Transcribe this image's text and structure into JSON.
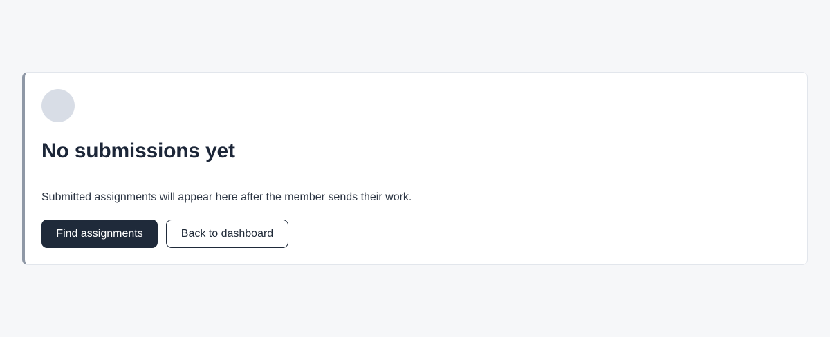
{
  "empty_state": {
    "title": "No submissions yet",
    "description": "Submitted assignments will appear here after the member sends their work.",
    "primary_action": "Find assignments",
    "secondary_action": "Back to dashboard"
  },
  "colors": {
    "page_background": "#f6f7f9",
    "card_background": "#ffffff",
    "accent_border": "#8f98a6",
    "avatar_placeholder": "#d8dde6",
    "primary_button": "#1f2a3a"
  }
}
